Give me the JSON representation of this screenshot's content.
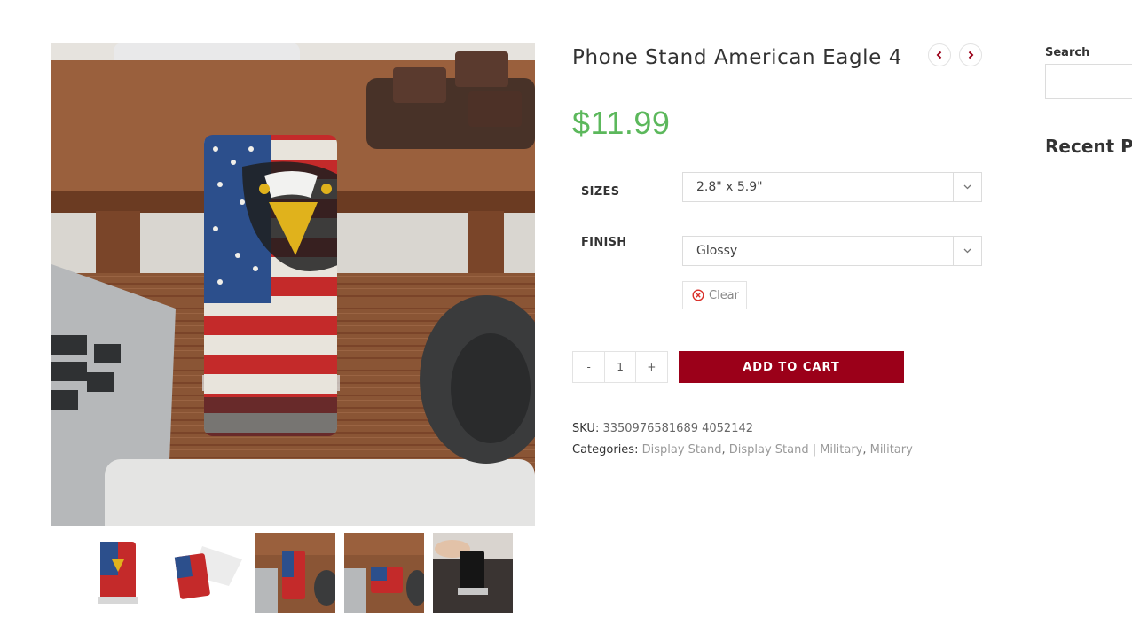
{
  "product": {
    "title": "Phone Stand American Eagle 4",
    "price": "$11.99",
    "price_color": "#5cb85c",
    "prev_icon": "chevron-left-icon",
    "next_icon": "chevron-right-icon"
  },
  "variations": {
    "sizes_label": "SIZES",
    "sizes_value": "2.8\" x 5.9\"",
    "finish_label": "FINISH",
    "finish_value": "Glossy",
    "clear_label": "Clear"
  },
  "cart": {
    "minus": "-",
    "quantity": "1",
    "plus": "+",
    "add_label": "ADD TO CART",
    "button_color": "#9b0019"
  },
  "meta": {
    "sku_label": "SKU:",
    "sku_value": "3350976581689 4052142",
    "categories_label": "Categories:",
    "categories": [
      "Display Stand",
      "Display Stand | Military",
      "Military"
    ]
  },
  "sidebar": {
    "search_label": "Search",
    "recent_heading": "Recent Posts"
  },
  "thumbnails": [
    "thumb-1",
    "thumb-2",
    "thumb-3",
    "thumb-4",
    "thumb-5"
  ]
}
